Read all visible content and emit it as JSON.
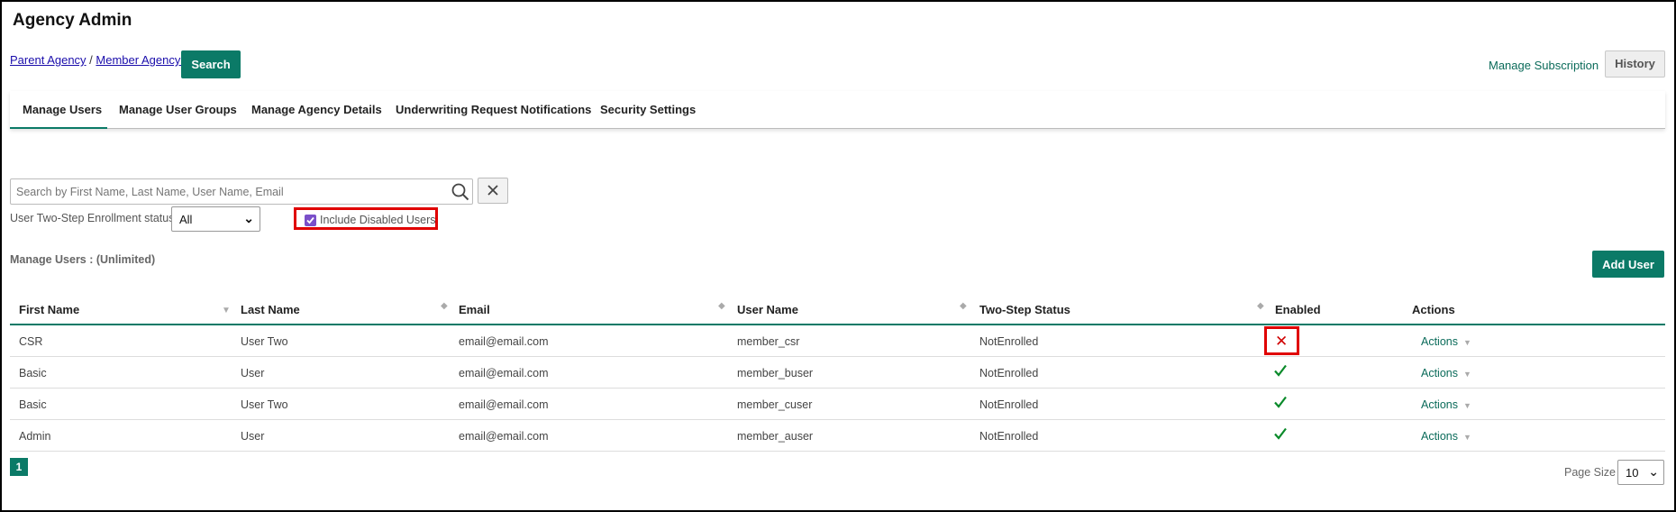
{
  "app": {
    "title": "Agency Admin"
  },
  "breadcrumb": {
    "parent": "Parent Agency",
    "separator": " / ",
    "member": "Member Agency A"
  },
  "header": {
    "search_label": "Search",
    "manage_subscription": "Manage Subscription",
    "history_label": "History"
  },
  "tabs": [
    {
      "label": "Manage Users",
      "active": true
    },
    {
      "label": "Manage User Groups"
    },
    {
      "label": "Manage Agency Details"
    },
    {
      "label": "Underwriting Request Notifications"
    },
    {
      "label": "Security Settings"
    }
  ],
  "search": {
    "placeholder": "Search by First Name, Last Name, User Name, Email",
    "value": ""
  },
  "filters": {
    "enrollment_label": "User Two-Step Enrollment status",
    "enrollment_value": "All",
    "include_disabled_label": "Include Disabled Users",
    "include_disabled_checked": true
  },
  "summary": {
    "label": "Manage Users : (Unlimited)",
    "add_user": "Add User"
  },
  "table": {
    "columns": [
      "First Name",
      "Last Name",
      "Email",
      "User Name",
      "Two-Step Status",
      "Enabled",
      "Actions"
    ],
    "rows": [
      {
        "first": "CSR",
        "last": "User Two",
        "email": "email@email.com",
        "username": "member_csr",
        "two_step": "NotEnrolled",
        "enabled": false,
        "actions": "Actions"
      },
      {
        "first": "Basic",
        "last": "User",
        "email": "email@email.com",
        "username": "member_buser",
        "two_step": "NotEnrolled",
        "enabled": true,
        "actions": "Actions"
      },
      {
        "first": "Basic",
        "last": "User Two",
        "email": "email@email.com",
        "username": "member_cuser",
        "two_step": "NotEnrolled",
        "enabled": true,
        "actions": "Actions"
      },
      {
        "first": "Admin",
        "last": "User",
        "email": "email@email.com",
        "username": "member_auser",
        "two_step": "NotEnrolled",
        "enabled": true,
        "actions": "Actions"
      }
    ]
  },
  "pagination": {
    "current_page": "1",
    "page_size_label": "Page Size",
    "page_size": "10"
  },
  "icons": {
    "disabled": "x-icon",
    "enabled": "check-icon",
    "search": "search-icon",
    "clear": "close-icon"
  },
  "colors": {
    "accent": "#0b7a67",
    "highlight": "#e00000",
    "disabled_x": "#d00000",
    "checkbox": "#7a4fc9"
  }
}
